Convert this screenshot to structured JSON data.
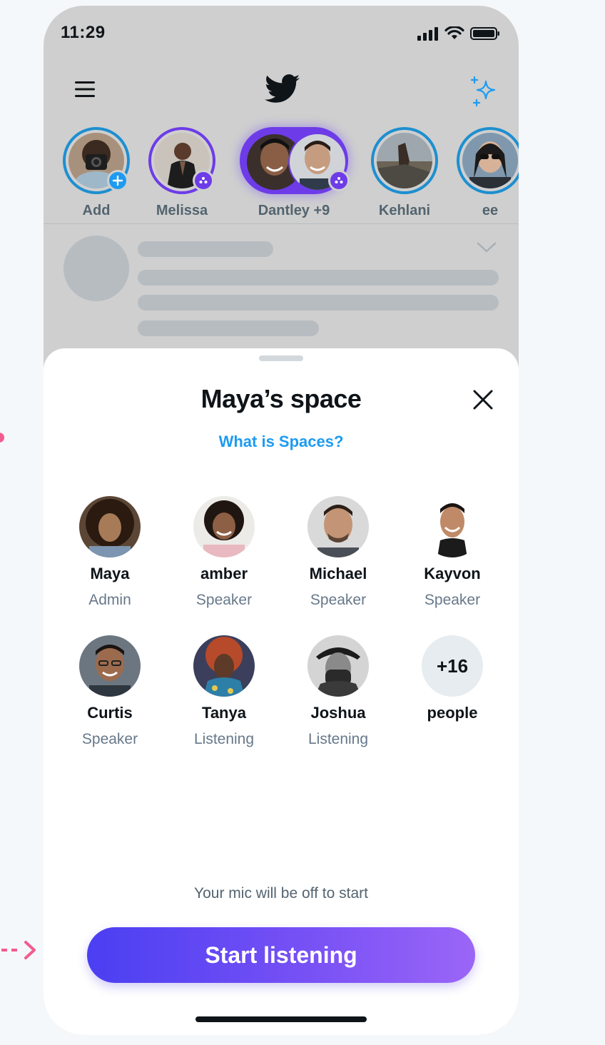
{
  "status_bar": {
    "time": "11:29"
  },
  "header": {
    "menu_icon": "hamburger-menu-icon",
    "logo_icon": "twitter-bird-icon",
    "sparkle_icon": "sparkle-icon"
  },
  "fleets": [
    {
      "label": "Add"
    },
    {
      "label": "Melissa"
    },
    {
      "label": "Dantley +9"
    },
    {
      "label": "Kehlani"
    },
    {
      "label": "ee"
    }
  ],
  "sheet": {
    "title": "Maya’s space",
    "what_is_link": "What is Spaces?",
    "participants": [
      {
        "name": "Maya",
        "role": "Admin"
      },
      {
        "name": "amber",
        "role": "Speaker"
      },
      {
        "name": "Michael",
        "role": "Speaker"
      },
      {
        "name": "Kayvon",
        "role": "Speaker"
      },
      {
        "name": "Curtis",
        "role": "Speaker"
      },
      {
        "name": "Tanya",
        "role": "Listening"
      },
      {
        "name": "Joshua",
        "role": "Listening"
      }
    ],
    "more": {
      "count": "+16",
      "label": "people"
    },
    "mic_note": "Your mic will be off to start",
    "start_button": "Start listening"
  },
  "colors": {
    "accent_blue": "#1d9bf0",
    "spaces_purple": "#6d3ce8",
    "button_gradient_start": "#4a3ff2",
    "button_gradient_end": "#9b66f7",
    "annotation_pink": "#f25c8f"
  }
}
